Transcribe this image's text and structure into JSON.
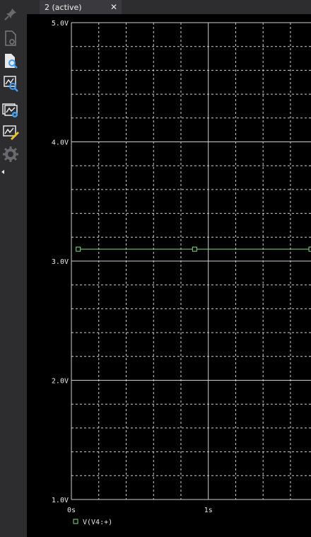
{
  "tab": {
    "label": "2 (active)",
    "close_glyph": "✕"
  },
  "toolbar": {
    "buttons": [
      {
        "name": "pin-icon",
        "enabled": false
      },
      {
        "name": "document-settings-icon",
        "enabled": false
      },
      {
        "name": "document-search-icon",
        "enabled": true
      },
      {
        "name": "plot-zoom-icon",
        "enabled": true
      },
      {
        "name": "plot-settings-icon",
        "enabled": true
      },
      {
        "name": "plot-edit-icon",
        "enabled": true
      },
      {
        "name": "gear-icon",
        "enabled": false
      }
    ]
  },
  "colors": {
    "background": "#000000",
    "grid": "#cfcfcf",
    "trace": "#7fdc7f",
    "accent_blue": "#3aa0ff",
    "accent_yellow": "#f2c01e"
  },
  "chart_data": {
    "type": "line",
    "x_tick_labels": [
      "0s",
      "1s"
    ],
    "y_tick_labels": [
      "5.0V",
      "4.0V",
      "3.0V",
      "2.0V",
      "1.0V"
    ],
    "x_ticks": [
      0,
      1
    ],
    "y_ticks": [
      5.0,
      4.0,
      3.0,
      2.0,
      1.0
    ],
    "xlim": [
      0,
      1.75
    ],
    "ylim": [
      1.0,
      5.0
    ],
    "grid": true,
    "legend_position": "bottom-left",
    "series": [
      {
        "name": "V(V4:+)",
        "marker": "square",
        "x": [
          0.05,
          0.9,
          1.75
        ],
        "y": [
          3.1,
          3.1,
          3.1
        ],
        "marker_x": [
          0.05,
          0.9,
          1.75
        ]
      }
    ]
  }
}
